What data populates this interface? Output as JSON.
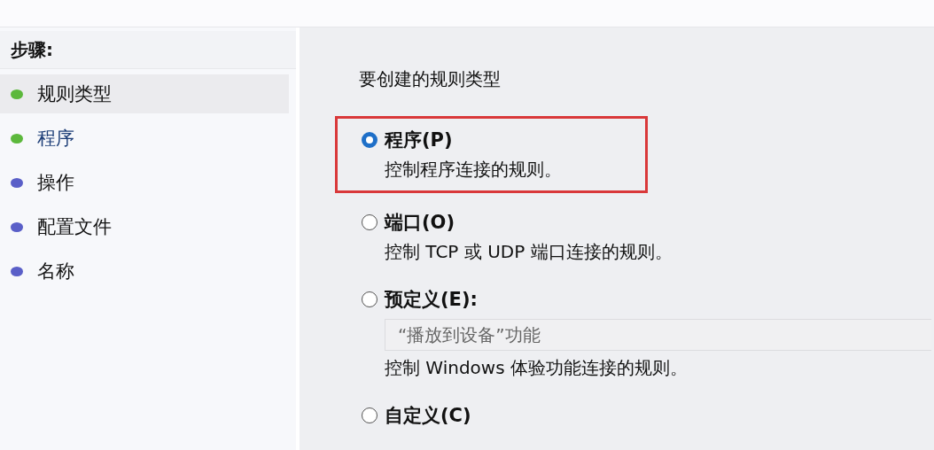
{
  "steps": {
    "title": "步骤:",
    "items": [
      {
        "label": "规则类型",
        "color": "#5cb83c",
        "selected": false,
        "highlighted": true
      },
      {
        "label": "程序",
        "color": "#5cb83c",
        "selected": true,
        "highlighted": false
      },
      {
        "label": "操作",
        "color": "#5a5fc8",
        "selected": false,
        "highlighted": false
      },
      {
        "label": "配置文件",
        "color": "#5a5fc8",
        "selected": false,
        "highlighted": false
      },
      {
        "label": "名称",
        "color": "#5a5fc8",
        "selected": false,
        "highlighted": false
      }
    ]
  },
  "content": {
    "heading": "要创建的规则类型",
    "options": [
      {
        "label": "程序(P)",
        "description": "控制程序连接的规则。",
        "selected": true,
        "highlighted": true
      },
      {
        "label": "端口(O)",
        "description": "控制 TCP 或 UDP 端口连接的规则。",
        "selected": false,
        "highlighted": false
      },
      {
        "label": "预定义(E):",
        "dropdown_value": "“播放到设备”功能",
        "description": "控制 Windows 体验功能连接的规则。",
        "selected": false,
        "highlighted": false
      },
      {
        "label": "自定义(C)",
        "selected": false,
        "highlighted": false
      }
    ]
  }
}
